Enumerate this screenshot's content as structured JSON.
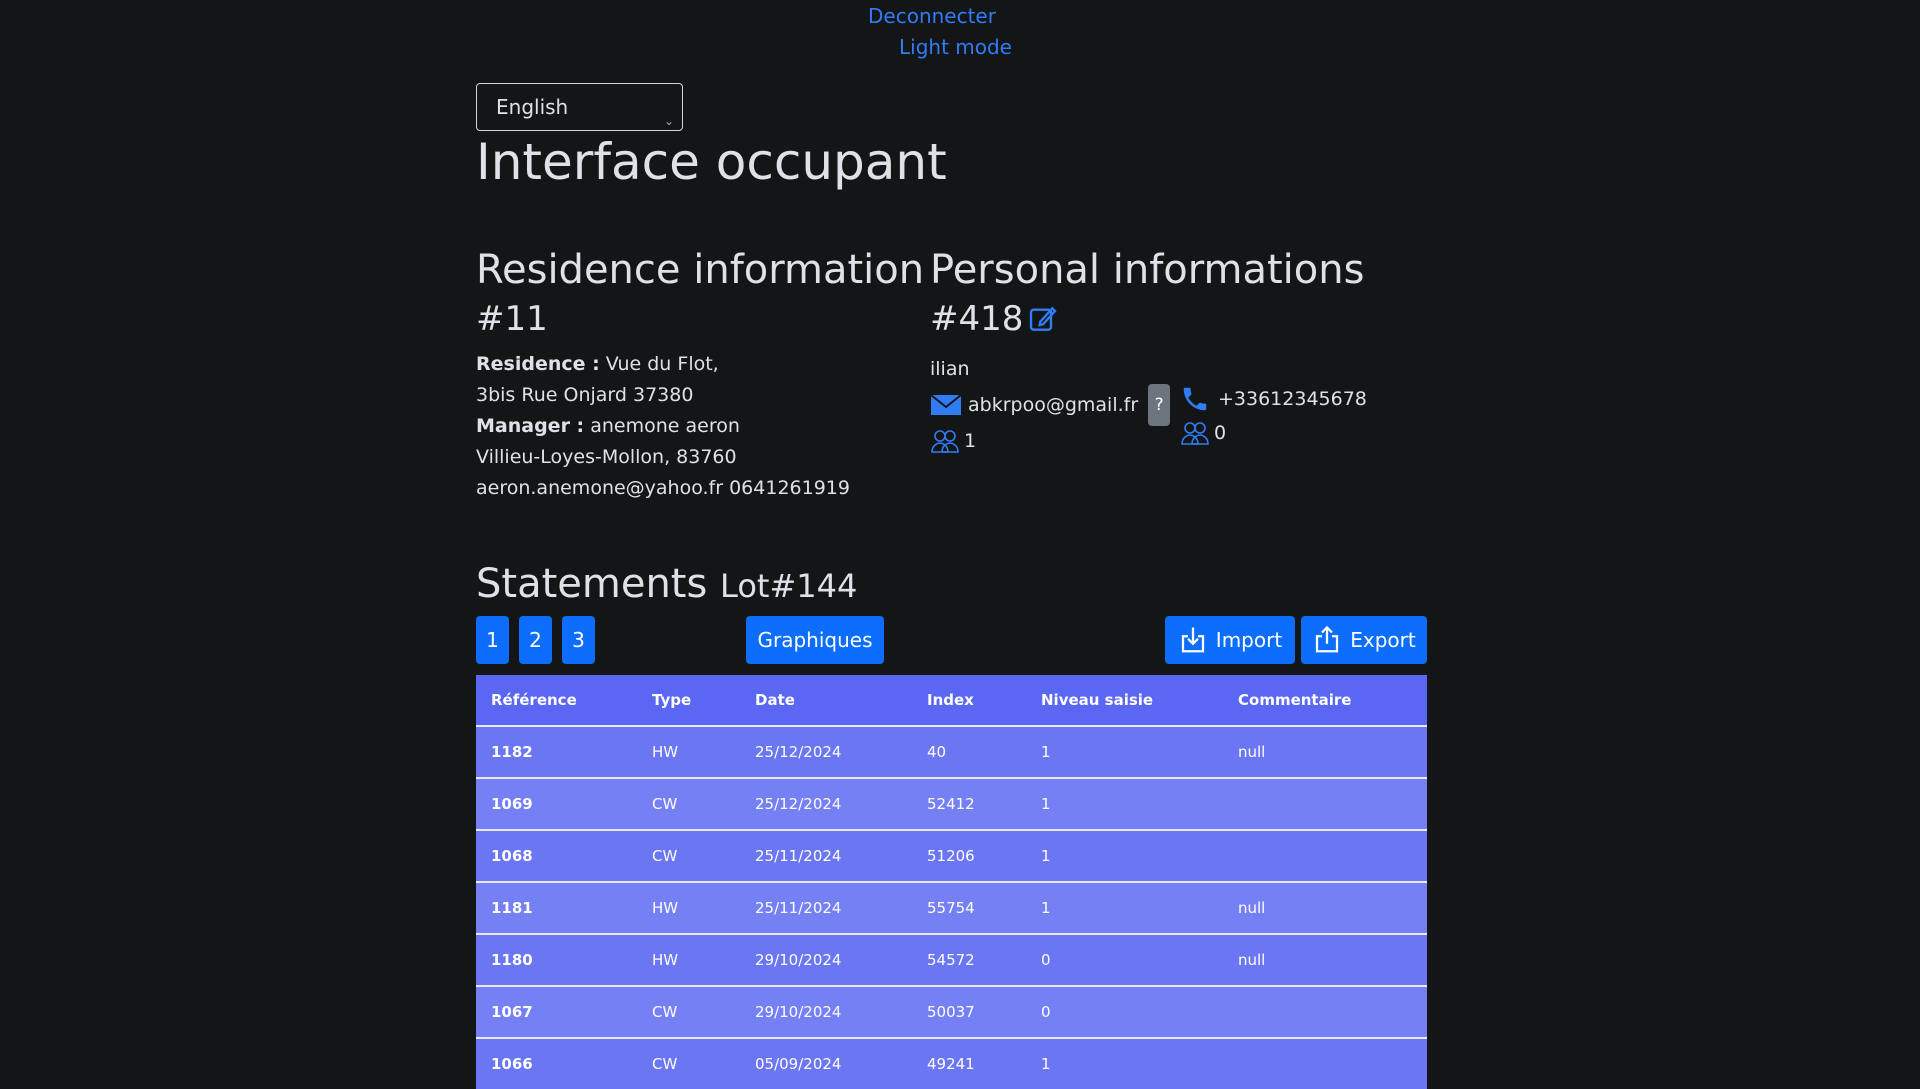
{
  "nav": {
    "logout": "Deconnecter",
    "theme_toggle": "Light mode"
  },
  "language": {
    "selected": "English"
  },
  "page_title": "Interface occupant",
  "residence": {
    "title": "Residence information",
    "id": "#11",
    "residence_label": "Residence :",
    "residence_name": "Vue du Flot,",
    "address": "3bis Rue Onjard 37380",
    "manager_label": "Manager :",
    "manager_name": "anemone aeron",
    "manager_city": "Villieu-Loyes-Mollon, 83760",
    "manager_contact": "aeron.anemone@yahoo.fr 0641261919"
  },
  "personal": {
    "title": "Personal informations",
    "id": "#418",
    "name": "ilian",
    "email": "abkrpoo@gmail.fr",
    "help": "?",
    "phone": "+33612345678",
    "count_a": "1",
    "count_b": "0"
  },
  "statements": {
    "title": "Statements",
    "lot": "Lot#144",
    "pages": [
      "1",
      "2",
      "3"
    ],
    "graph_button": "Graphiques",
    "import_button": "Import",
    "export_button": "Export",
    "columns": [
      "Référence",
      "Type",
      "Date",
      "Index",
      "Niveau saisie",
      "Commentaire"
    ],
    "rows": [
      [
        "1182",
        "HW",
        "25/12/2024",
        "40",
        "1",
        "null"
      ],
      [
        "1069",
        "CW",
        "25/12/2024",
        "52412",
        "1",
        ""
      ],
      [
        "1068",
        "CW",
        "25/11/2024",
        "51206",
        "1",
        ""
      ],
      [
        "1181",
        "HW",
        "25/11/2024",
        "55754",
        "1",
        "null"
      ],
      [
        "1180",
        "HW",
        "29/10/2024",
        "54572",
        "0",
        "null"
      ],
      [
        "1067",
        "CW",
        "29/10/2024",
        "50037",
        "0",
        ""
      ],
      [
        "1066",
        "CW",
        "05/09/2024",
        "49241",
        "1",
        ""
      ]
    ]
  },
  "colors": {
    "background": "#141517",
    "accent": "#0d6efd",
    "table_header": "#5a67f2",
    "table_row": "#6a76f2"
  }
}
